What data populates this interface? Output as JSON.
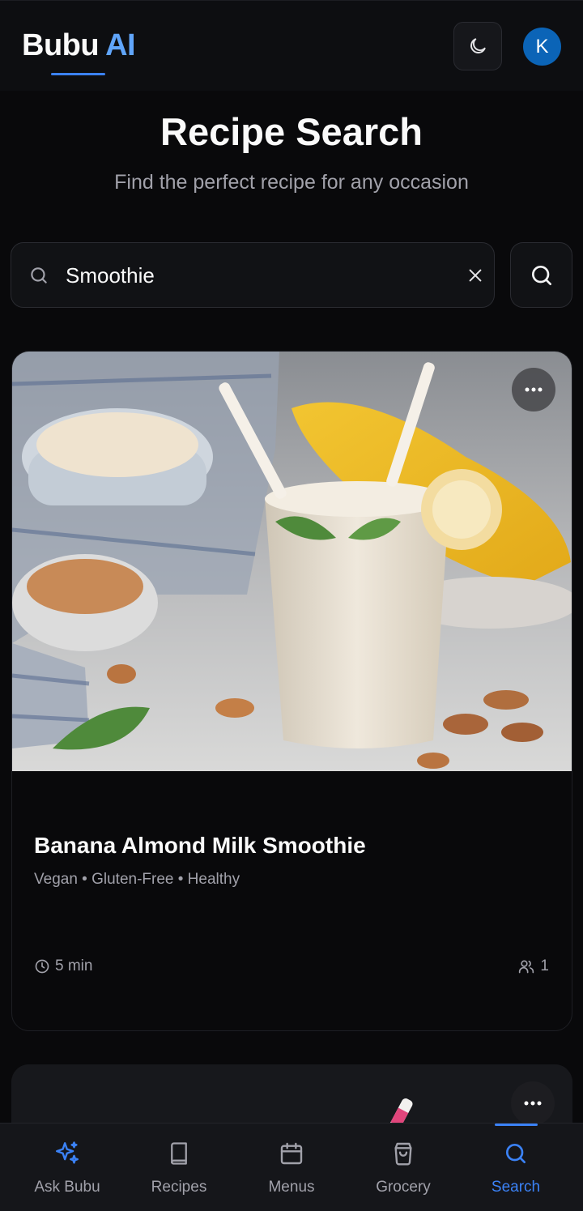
{
  "header": {
    "brand_name": "Bubu",
    "brand_accent": "AI",
    "theme_icon": "moon-icon",
    "avatar_initial": "K"
  },
  "page": {
    "title": "Recipe Search",
    "subtitle": "Find the perfect recipe for any occasion"
  },
  "search": {
    "value": "Smoothie",
    "icon": "search-icon",
    "clear_icon": "close-icon",
    "submit_icon": "search-icon"
  },
  "results": [
    {
      "title": "Banana Almond Milk Smoothie",
      "tags": "Vegan • Gluten-Free • Healthy",
      "time": "5 min",
      "servings": "1",
      "image": "smoothie-photo"
    },
    {
      "image": "smoothie-photo"
    }
  ],
  "nav": {
    "items": [
      {
        "label": "Ask Bubu",
        "icon": "sparkles-icon"
      },
      {
        "label": "Recipes",
        "icon": "book-icon"
      },
      {
        "label": "Menus",
        "icon": "calendar-icon"
      },
      {
        "label": "Grocery",
        "icon": "shopping-bag-icon"
      },
      {
        "label": "Search",
        "icon": "search-icon"
      }
    ],
    "active": "Search"
  },
  "colors": {
    "accent": "#3b82f6",
    "brand_accent": "#60a5fa",
    "background": "#09090b",
    "muted_text": "#a1a1aa",
    "avatar": "#0b64b7"
  }
}
